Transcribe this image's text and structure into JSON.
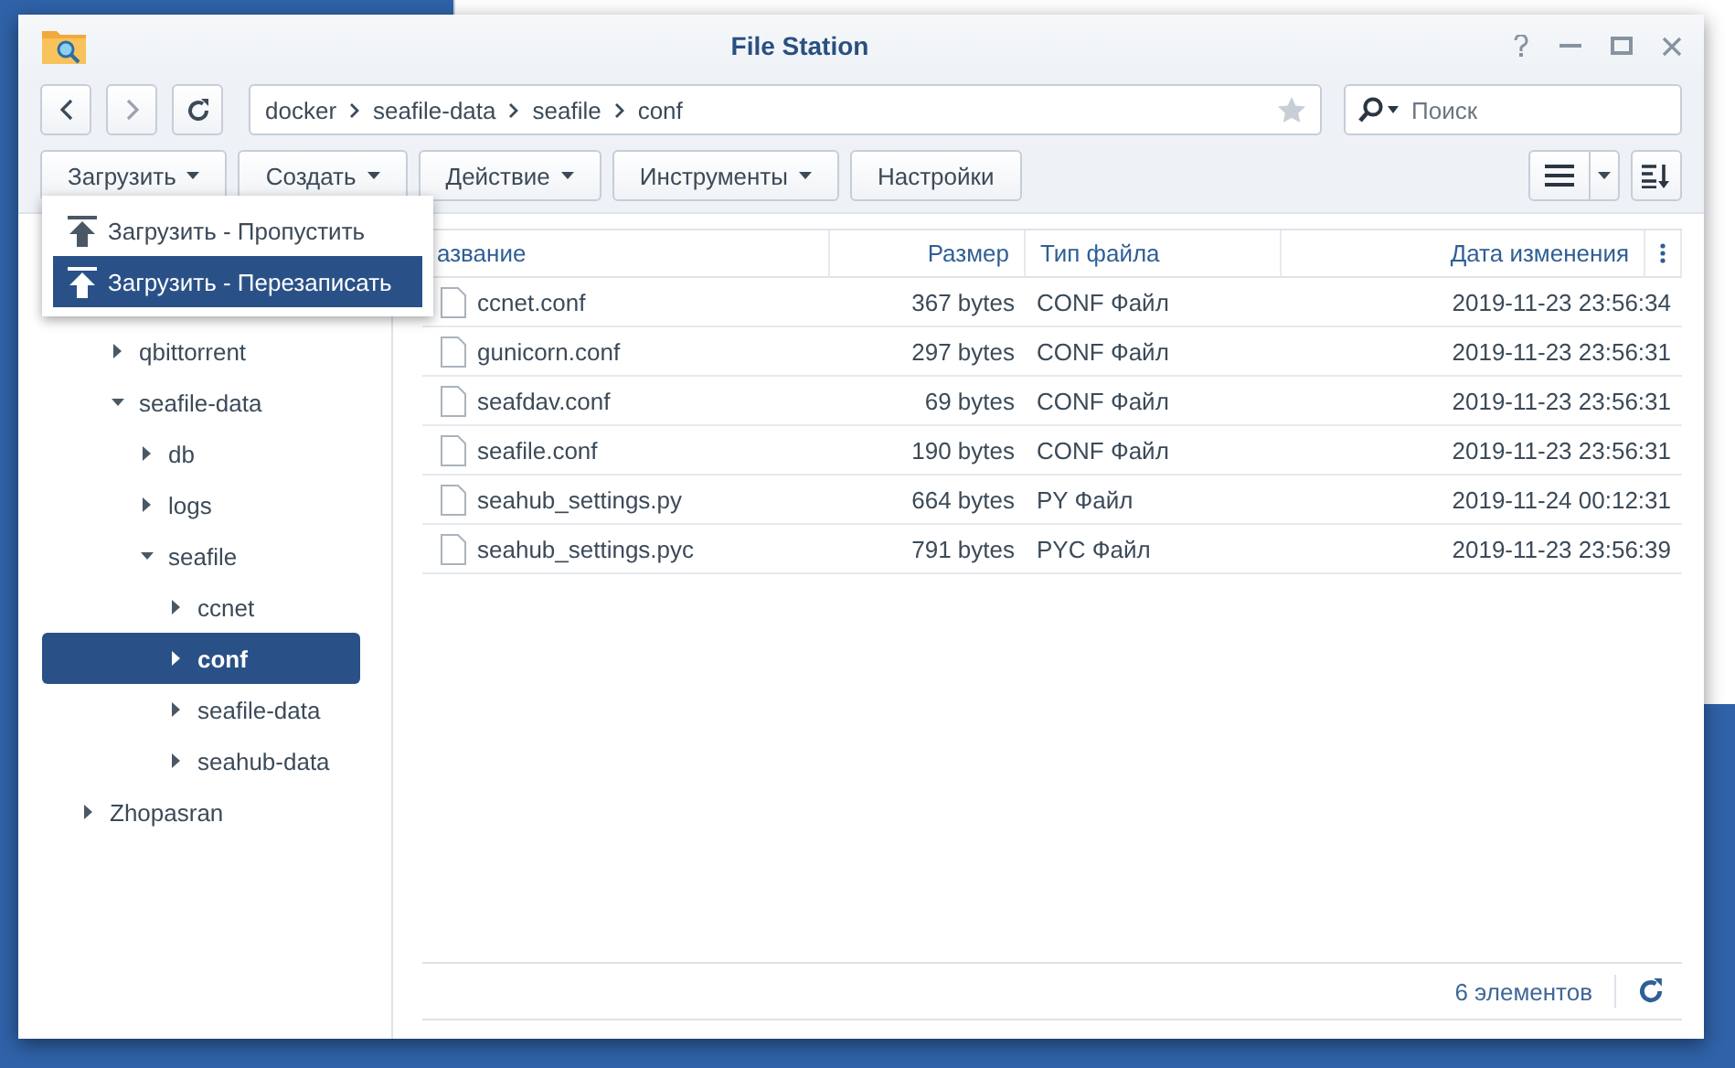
{
  "window": {
    "title": "File Station"
  },
  "nav": {
    "path": [
      "docker",
      "seafile-data",
      "seafile",
      "conf"
    ],
    "search": {
      "placeholder": "Поиск"
    }
  },
  "toolbar": [
    {
      "label": "Загрузить",
      "menu": true
    },
    {
      "label": "Создать",
      "menu": true
    },
    {
      "label": "Действие",
      "menu": true
    },
    {
      "label": "Инструменты",
      "menu": true
    },
    {
      "label": "Настройки",
      "menu": false
    }
  ],
  "upload_menu": [
    {
      "label": "Загрузить - Пропустить",
      "selected": false
    },
    {
      "label": "Загрузить - Перезаписать",
      "selected": true
    }
  ],
  "tree": [
    {
      "children": [
        {
          "label": "qbittorrent",
          "expanded": false,
          "selected": false
        },
        {
          "label": "seafile-data",
          "expanded": true,
          "selected": false,
          "children": [
            {
              "label": "db",
              "expanded": false,
              "selected": false
            },
            {
              "label": "logs",
              "expanded": false,
              "selected": false
            },
            {
              "label": "seafile",
              "expanded": true,
              "selected": false,
              "children": [
                {
                  "label": "ccnet",
                  "expanded": false,
                  "selected": false
                },
                {
                  "label": "conf",
                  "expanded": false,
                  "selected": true
                },
                {
                  "label": "seafile-data",
                  "expanded": false,
                  "selected": false
                },
                {
                  "label": "seahub-data",
                  "expanded": false,
                  "selected": false
                }
              ]
            }
          ]
        }
      ]
    },
    {
      "label": "Zhopasran",
      "expanded": false,
      "selected": false
    }
  ],
  "table": {
    "columns": [
      "азвание",
      "Размер",
      "Тип файла",
      "Дата изменения"
    ],
    "rows": [
      {
        "name": "ccnet.conf",
        "size": "367 bytes",
        "type": "CONF Файл",
        "modified": "2019-11-23 23:56:34"
      },
      {
        "name": "gunicorn.conf",
        "size": "297 bytes",
        "type": "CONF Файл",
        "modified": "2019-11-23 23:56:31"
      },
      {
        "name": "seafdav.conf",
        "size": "69 bytes",
        "type": "CONF Файл",
        "modified": "2019-11-23 23:56:31"
      },
      {
        "name": "seafile.conf",
        "size": "190 bytes",
        "type": "CONF Файл",
        "modified": "2019-11-23 23:56:31"
      },
      {
        "name": "seahub_settings.py",
        "size": "664 bytes",
        "type": "PY Файл",
        "modified": "2019-11-24 00:12:31"
      },
      {
        "name": "seahub_settings.pyc",
        "size": "791 bytes",
        "type": "PYC Файл",
        "modified": "2019-11-23 23:56:39"
      }
    ]
  },
  "status_bar": {
    "count": "6 элементов"
  }
}
